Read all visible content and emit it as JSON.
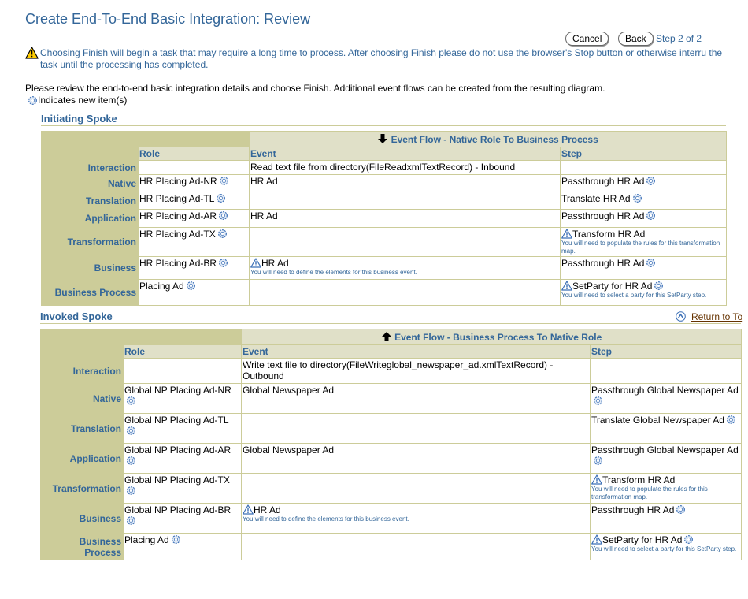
{
  "page": {
    "title": "Create End-To-End Basic Integration: Review",
    "cancel_label": "Cancel",
    "back_label": "Back",
    "step_text": "Step 2 of 2",
    "warning_text": "Choosing Finish will begin a task that may require a long time to process. After choosing Finish please do not use the browser's Stop button or otherwise interru the task until the processing has completed.",
    "review_text": "Please review the end-to-end basic integration details and choose Finish. Additional event flows can be created from the resulting diagram.",
    "new_item_legend": "Indicates new item(s)",
    "return_link": "Return to To"
  },
  "colors": {
    "accent": "#336699",
    "header_bg": "#cccc99",
    "subheader_bg": "#e0e0c8",
    "link": "#663300"
  },
  "icons": {
    "new_item": "new-item-icon",
    "warning": "warning-icon",
    "arrow_down": "arrow-down-icon",
    "arrow_up": "arrow-up-icon"
  },
  "initiating": {
    "heading": "Initiating Spoke",
    "flow_header": "Event Flow - Native Role To Business Process",
    "col_role": "Role",
    "col_event": "Event",
    "col_step": "Step",
    "rows": [
      {
        "label": "Interaction",
        "role": "",
        "role_new": false,
        "event": "Read text file from directory(FileReadxmlTextRecord) - Inbound",
        "event_warn": false,
        "event_note": "",
        "step": "",
        "step_new": false,
        "step_warn": false,
        "step_note": ""
      },
      {
        "label": "Native",
        "role": "HR Placing Ad-NR",
        "role_new": true,
        "event": "HR Ad",
        "event_warn": false,
        "event_note": "",
        "step": "Passthrough HR Ad",
        "step_new": true,
        "step_warn": false,
        "step_note": ""
      },
      {
        "label": "Translation",
        "role": "HR Placing Ad-TL",
        "role_new": true,
        "event": "",
        "event_warn": false,
        "event_note": "",
        "step": "Translate HR Ad",
        "step_new": true,
        "step_warn": false,
        "step_note": ""
      },
      {
        "label": "Application",
        "role": "HR Placing Ad-AR",
        "role_new": true,
        "event": "HR Ad",
        "event_warn": false,
        "event_note": "",
        "step": "Passthrough HR Ad",
        "step_new": true,
        "step_warn": false,
        "step_note": ""
      },
      {
        "label": "Transformation",
        "role": "HR Placing Ad-TX",
        "role_new": true,
        "event": "",
        "event_warn": false,
        "event_note": "",
        "step": "Transform HR Ad",
        "step_new": false,
        "step_warn": true,
        "step_note": "You will need to populate the rules for this transformation map."
      },
      {
        "label": "Business",
        "role": "HR Placing Ad-BR",
        "role_new": true,
        "event": "HR Ad",
        "event_warn": true,
        "event_note": "You will need to define the elements for this business event.",
        "step": "Passthrough HR Ad",
        "step_new": true,
        "step_warn": false,
        "step_note": ""
      },
      {
        "label": "Business Process",
        "role": "Placing Ad",
        "role_new": true,
        "event": "",
        "event_warn": false,
        "event_note": "",
        "step": "SetParty for HR Ad",
        "step_new": true,
        "step_warn": true,
        "step_note": "You will need to select a party for this SetParty step."
      }
    ]
  },
  "invoked": {
    "heading": "Invoked Spoke",
    "flow_header": "Event Flow - Business Process To Native Role",
    "col_role": "Role",
    "col_event": "Event",
    "col_step": "Step",
    "rows": [
      {
        "label": "Interaction",
        "role": "",
        "role_new": false,
        "event": "Write text file to directory(FileWriteglobal_newspaper_ad.xmlTextRecord) - Outbound",
        "event_warn": false,
        "event_note": "",
        "step": "",
        "step_new": false,
        "step_warn": false,
        "step_note": ""
      },
      {
        "label": "Native",
        "role": "Global NP Placing Ad-NR",
        "role_new": true,
        "event": "Global Newspaper Ad",
        "event_warn": false,
        "event_note": "",
        "step": "Passthrough Global Newspaper Ad",
        "step_new": true,
        "step_warn": false,
        "step_note": ""
      },
      {
        "label": "Translation",
        "role": "Global NP Placing Ad-TL",
        "role_new": true,
        "event": "",
        "event_warn": false,
        "event_note": "",
        "step": "Translate Global Newspaper Ad",
        "step_new": true,
        "step_warn": false,
        "step_note": ""
      },
      {
        "label": "Application",
        "role": "Global NP Placing Ad-AR",
        "role_new": true,
        "event": "Global Newspaper Ad",
        "event_warn": false,
        "event_note": "",
        "step": "Passthrough Global Newspaper Ad",
        "step_new": true,
        "step_warn": false,
        "step_note": ""
      },
      {
        "label": "Transformation",
        "role": "Global NP Placing Ad-TX",
        "role_new": true,
        "event": "",
        "event_warn": false,
        "event_note": "",
        "step": "Transform HR Ad",
        "step_new": false,
        "step_warn": true,
        "step_note": "You will need to populate the rules for this transformation map."
      },
      {
        "label": "Business",
        "role": "Global NP Placing Ad-BR",
        "role_new": true,
        "event": "HR Ad",
        "event_warn": true,
        "event_note": "You will need to define the elements for this business event.",
        "step": "Passthrough HR Ad",
        "step_new": true,
        "step_warn": false,
        "step_note": ""
      },
      {
        "label": "Business Process",
        "role": "Placing Ad",
        "role_new": true,
        "event": "",
        "event_warn": false,
        "event_note": "",
        "step": "SetParty for HR Ad",
        "step_new": true,
        "step_warn": true,
        "step_note": "You will need to select a party for this SetParty step."
      }
    ]
  }
}
